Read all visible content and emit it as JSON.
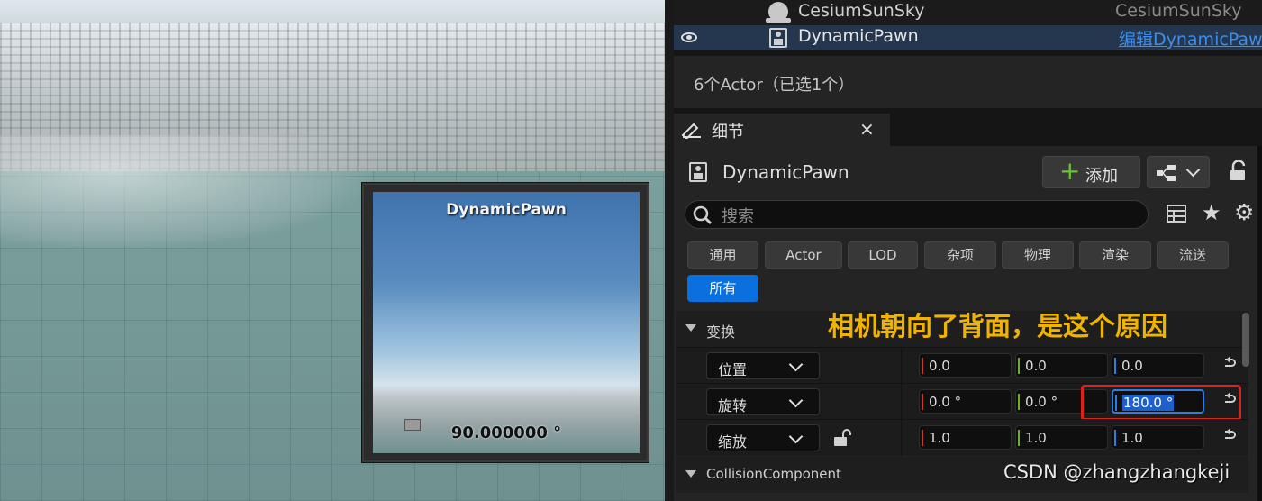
{
  "viewport": {
    "preview_title": "DynamicPawn",
    "preview_angle": "90.000000 °"
  },
  "outliner": {
    "rows": [
      {
        "label": "CesiumSunSky",
        "type": "CesiumSunSky"
      },
      {
        "label": "DynamicPawn",
        "type": "编辑DynamicPawn"
      }
    ],
    "status": "6个Actor（已选1个）"
  },
  "details": {
    "tab_label": "细节",
    "close_glyph": "×",
    "actor_name": "DynamicPawn",
    "add_label": "添加",
    "search_placeholder": "搜索",
    "categories": [
      "通用",
      "Actor",
      "LOD",
      "杂项",
      "物理",
      "渲染",
      "流送",
      "所有"
    ],
    "selected_category": "所有",
    "section_transform": "变换",
    "annotation": "相机朝向了背面，是这个原因",
    "properties": [
      {
        "label": "位置",
        "x": "0.0",
        "y": "0.0",
        "z": "0.0"
      },
      {
        "label": "旋转",
        "x": "0.0 °",
        "y": "0.0 °",
        "z": "180.0 °"
      },
      {
        "label": "缩放",
        "x": "1.0",
        "y": "1.0",
        "z": "1.0"
      }
    ],
    "section_collision": "CollisionComponent",
    "watermark": "CSDN @zhangzhangkeji"
  },
  "colors": {
    "accent": "#0a70e0",
    "highlight_box": "#e0201a",
    "annotation": "#f0b400",
    "selected_row": "#24374f"
  }
}
